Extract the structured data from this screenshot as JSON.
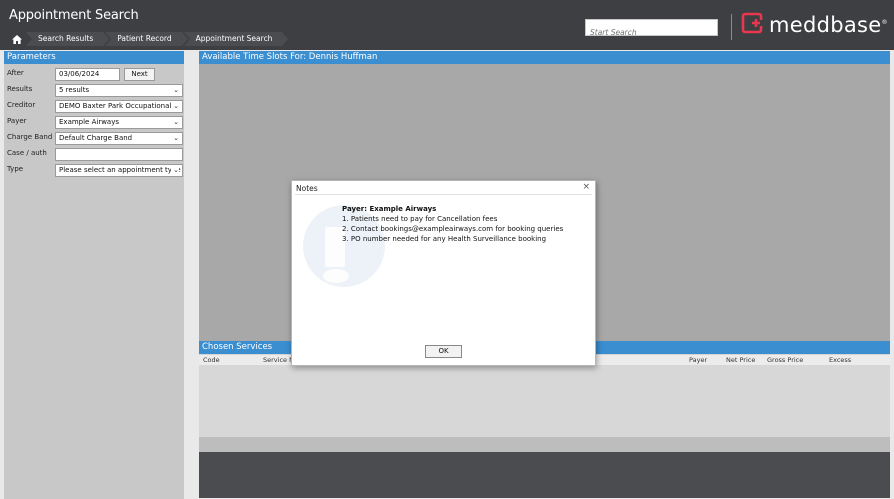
{
  "header": {
    "title": "Appointment Search",
    "breadcrumbs": [
      "Search Results",
      "Patient Record",
      "Appointment Search"
    ],
    "search_placeholder": "Start Search",
    "logo_text": "meddbase",
    "logo_reg": "®"
  },
  "params": {
    "title": "Parameters",
    "after_label": "After",
    "after_value": "03/06/2024",
    "next_label": "Next",
    "results_label": "Results",
    "results_value": "5 results",
    "creditor_label": "Creditor",
    "creditor_value": "DEMO Baxter Park Occupational H",
    "payer_label": "Payer",
    "payer_value": "Example Airways",
    "charge_band_label": "Charge Band",
    "charge_band_value": "Default Charge Band",
    "case_auth_label": "Case / auth",
    "case_auth_value": "",
    "type_label": "Type",
    "type_value": "Please select an appointment type"
  },
  "timeslots": {
    "title": "Available Time Slots For: Dennis Huffman"
  },
  "chosen": {
    "title": "Chosen Services",
    "columns": {
      "code": "Code",
      "service_name": "Service Na",
      "payer": "Payer",
      "net_price": "Net Price",
      "gross_price": "Gross Price",
      "excess": "Excess"
    }
  },
  "modal": {
    "title": "Notes",
    "close": "×",
    "heading": "Payer: Example Airways",
    "lines": [
      "1. Patients need to pay for Cancellation fees",
      "2. Contact bookings@exampleairways.com for booking queries",
      "3. PO number needed for any Health Surveillance booking"
    ],
    "ok_label": "OK"
  },
  "colors": {
    "header_bg": "#3d3f42",
    "section_blue": "#3b8ed0",
    "logo_red": "#e8384f"
  },
  "icons": [
    "home-icon",
    "meddbase-logo-icon",
    "chevron-down-icon",
    "close-icon"
  ]
}
